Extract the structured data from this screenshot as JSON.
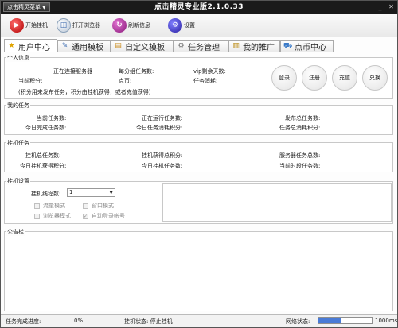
{
  "titlebar": {
    "menu_label": "点击精灵菜单",
    "title": "点击精灵专业版2.1.0.33",
    "min_glyph": "_",
    "close_glyph": "✕"
  },
  "toolbar": {
    "start": "开始挂机",
    "open_browser": "打开浏览器",
    "refresh": "刷新信息",
    "settings": "设置"
  },
  "tabs": [
    {
      "label": "用户中心",
      "icon": "star-icon",
      "glyph": "★"
    },
    {
      "label": "通用模板",
      "icon": "wrench-icon",
      "glyph": "✎"
    },
    {
      "label": "自定义模板",
      "icon": "folder-icon",
      "glyph": "▤"
    },
    {
      "label": "任务管理",
      "icon": "gear-icon",
      "glyph": "⚙"
    },
    {
      "label": "我的推广",
      "icon": "document-icon",
      "glyph": "▥"
    },
    {
      "label": "点币中心",
      "icon": "cart-icon",
      "glyph": "⛟"
    }
  ],
  "personal": {
    "legend": "个人信息",
    "status": "正在连接服务器",
    "per_group_tasks": "每分组任务数:",
    "vip_days": "vip剩余天数:",
    "current_points": "当前积分:",
    "coins": "点币:",
    "task_consumption": "任务消耗:",
    "note": "(积分用来发布任务，积分由挂机获得，或者充值获得)",
    "buttons": {
      "login": "登录",
      "register": "注册",
      "recharge": "充值",
      "exchange": "兑换"
    }
  },
  "my_tasks": {
    "legend": "我的任务",
    "current_tasks": "当前任务数:",
    "running_tasks": "正在运行任务数:",
    "published_total": "发布总任务数:",
    "today_completed": "今日完成任务数:",
    "today_consumed_points": "今日任务消耗积分:",
    "total_consumed_points": "任务总消耗积分:"
  },
  "hang_tasks": {
    "legend": "挂机任务",
    "hang_total": "挂机总任务数:",
    "hang_earned_total": "挂机获得总积分:",
    "server_total": "服务器任务总数:",
    "today_earned": "今日挂机获得积分:",
    "today_hang_tasks": "今日挂机任务数:",
    "current_period_tasks": "当前时段任务数:"
  },
  "hang_settings": {
    "legend": "挂机设置",
    "thread_label": "挂机线程数:",
    "thread_value": "1",
    "options": {
      "traffic": "流量模式",
      "window": "窗口模式",
      "browser": "浏览器模式",
      "auto_login": "自动登录帐号"
    },
    "auto_login_checked": true
  },
  "bulletin": {
    "legend": "公告栏"
  },
  "status": {
    "progress_label": "任务完成进度:",
    "progress_value": "0%",
    "hang_status": "挂机状态: 停止挂机",
    "network_label": "网络状态:",
    "network_ms": "1000ms",
    "network_level": 0.45
  }
}
